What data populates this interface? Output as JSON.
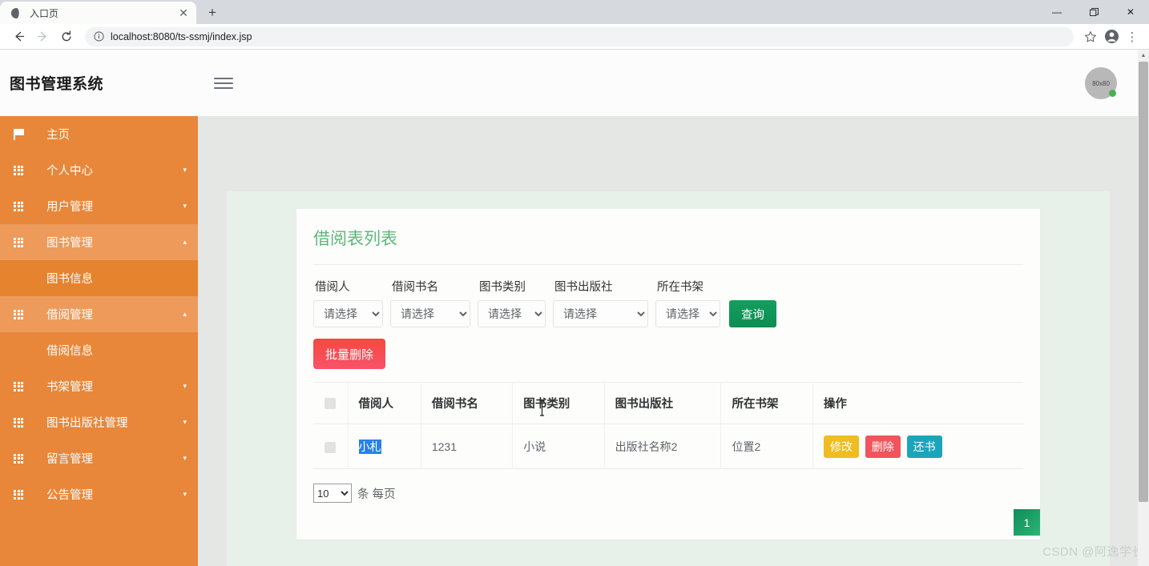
{
  "browser": {
    "tab_title": "入口页",
    "tab_favicon": "globe-icon",
    "close_label": "✕",
    "new_tab_label": "+",
    "back_label": "←",
    "forward_label": "→",
    "reload_label": "⟳",
    "info_label": "ⓘ",
    "url": "localhost:8080/ts-ssmj/index.jsp",
    "bookmark_label": "☆",
    "profile_label": "●",
    "menu_label": "⋮",
    "minimize_label": "—",
    "maximize_label": "❐",
    "window_close_label": "✕"
  },
  "header": {
    "app_title": "图书管理系统",
    "avatar_text": "80x80"
  },
  "sidebar": {
    "items": [
      {
        "label": "主页",
        "icon": "flag-icon",
        "has_caret": false,
        "expanded": false
      },
      {
        "label": "个人中心",
        "icon": "grid-icon",
        "has_caret": true,
        "caret": "▾",
        "expanded": false
      },
      {
        "label": "用户管理",
        "icon": "grid-icon",
        "has_caret": true,
        "caret": "▾",
        "expanded": false
      },
      {
        "label": "图书管理",
        "icon": "grid-icon",
        "has_caret": true,
        "caret": "▴",
        "expanded": true
      },
      {
        "label": "借阅管理",
        "icon": "grid-icon",
        "has_caret": true,
        "caret": "▴",
        "expanded": true
      },
      {
        "label": "书架管理",
        "icon": "grid-icon",
        "has_caret": true,
        "caret": "▾",
        "expanded": false
      },
      {
        "label": "图书出版社管理",
        "icon": "grid-icon",
        "has_caret": true,
        "caret": "▾",
        "expanded": false
      },
      {
        "label": "留言管理",
        "icon": "grid-icon",
        "has_caret": true,
        "caret": "▾",
        "expanded": false
      },
      {
        "label": "公告管理",
        "icon": "grid-icon",
        "has_caret": true,
        "caret": "▾",
        "expanded": false
      }
    ],
    "sub_book_info": "图书信息",
    "sub_borrow_info": "借阅信息"
  },
  "main": {
    "card_title": "借阅表列表",
    "filters": [
      {
        "label": "借阅人",
        "value": "请选择"
      },
      {
        "label": "借阅书名",
        "value": "请选择"
      },
      {
        "label": "图书类别",
        "value": "请选择"
      },
      {
        "label": "图书出版社",
        "value": "请选择"
      },
      {
        "label": "所在书架",
        "value": "请选择"
      }
    ],
    "query_button": "查询",
    "bulk_delete_button": "批量删除",
    "table": {
      "columns": [
        "",
        "借阅人",
        "借阅书名",
        "图书类别",
        "图书出版社",
        "所在书架",
        "操作"
      ],
      "rows": [
        {
          "borrower": "小札",
          "book_name": "1231",
          "category": "小说",
          "publisher": "出版社名称2",
          "shelf": "位置2",
          "actions": [
            {
              "label": "修改",
              "kind": "edit"
            },
            {
              "label": "删除",
              "kind": "delete"
            },
            {
              "label": "还书",
              "kind": "return"
            }
          ]
        }
      ]
    },
    "pagination": {
      "page_size": "10",
      "suffix": "条 每页",
      "current_page": "1"
    }
  },
  "watermark": "CSDN @阿逸学长",
  "colors": {
    "sidebar": "#e8873a",
    "sidebar_active": "#ee9a5b",
    "title_green": "#5cb87a",
    "query_green": "#0f9d58",
    "bulk_red": "#f5483f",
    "edit_yellow": "#f0bd20",
    "delete_red": "#f1545c",
    "return_teal": "#1aa5bb",
    "page_green": "#17a05f",
    "content_bg": "#e8f0ea"
  }
}
